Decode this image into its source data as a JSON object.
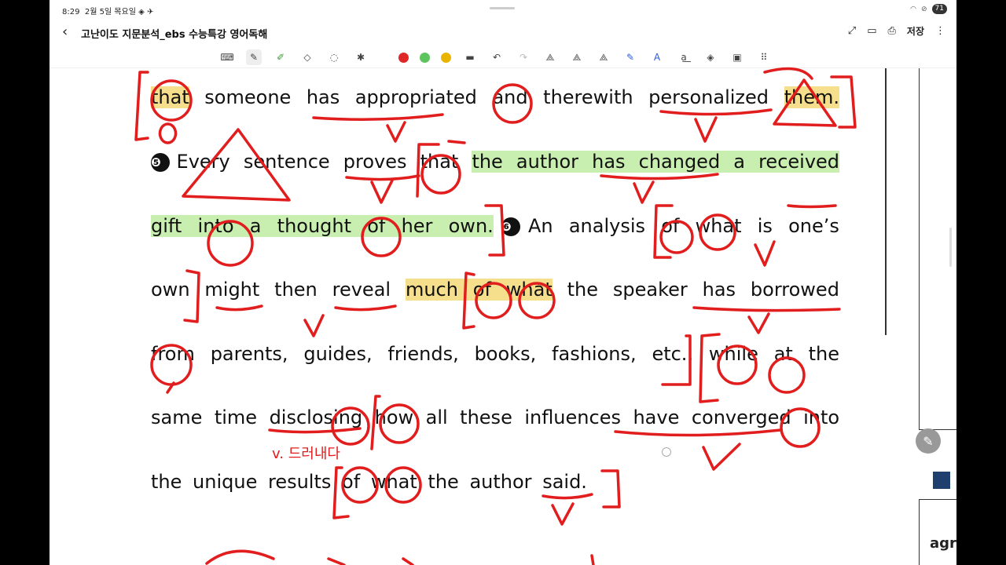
{
  "status": {
    "time": "8:29",
    "date": "2월 5일 목요일",
    "battery": "71"
  },
  "title": {
    "text": "고난이도 지문분석_ebs 수능특강 영어독해",
    "save": "저장"
  },
  "toolbar": {
    "colors": [
      "#e02727",
      "#5ec45e",
      "#e8b400"
    ]
  },
  "text": {
    "l1": [
      "that",
      "someone",
      "has",
      "appropriated",
      "and",
      "therewith",
      "personalized",
      "them."
    ],
    "l2_num": "❺",
    "l2": [
      "Every",
      "sentence",
      "proves",
      "that",
      "the",
      "author",
      "has",
      "changed",
      "a",
      "received"
    ],
    "l3": [
      "gift",
      "into",
      "a",
      "thought",
      "of",
      "her",
      "own."
    ],
    "l3_num": "❻",
    "l3b": [
      "An",
      "analysis",
      "of",
      "what",
      "is",
      "one’s"
    ],
    "l4": [
      "own",
      "might",
      "then",
      "reveal",
      "much",
      "of",
      "what",
      "the",
      "speaker",
      "has",
      "borrowed"
    ],
    "l5": [
      "from",
      "parents,",
      "guides,",
      "friends,",
      "books,",
      "fashions,",
      "etc.,",
      "while",
      "at",
      "the"
    ],
    "l6": [
      "same",
      "time",
      "disclosing",
      "how",
      "all",
      "these",
      "influences",
      "have",
      "converged",
      "into"
    ],
    "l7": [
      "the",
      "unique",
      "results",
      "of",
      "what",
      "the",
      "author",
      "said."
    ]
  },
  "annotation": {
    "note": "v. 드러내다"
  },
  "side": {
    "text": "agre"
  }
}
